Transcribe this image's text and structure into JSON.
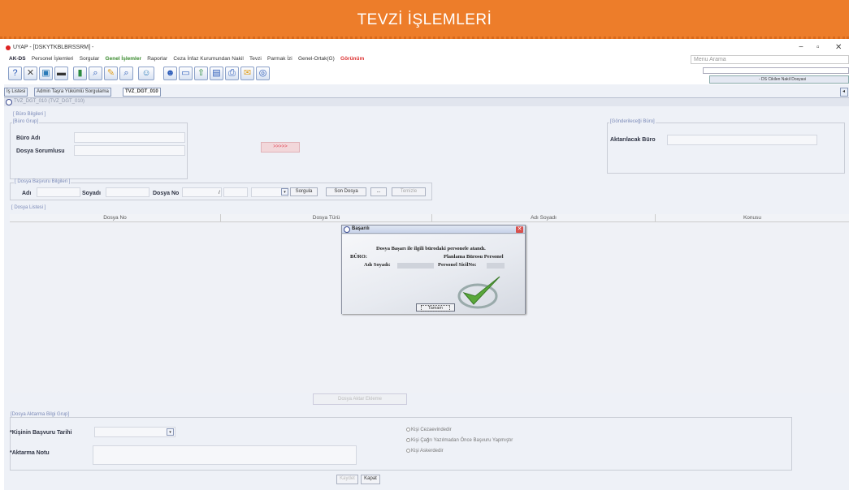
{
  "banner": {
    "title": "TEVZİ İŞLEMLERİ"
  },
  "window": {
    "title": "UYAP - [DSKYTKBLBRSSRM] -",
    "controls": {
      "minimize": "−",
      "restore": "▫",
      "close": "✕"
    }
  },
  "menu": {
    "items": [
      "AK-DS",
      "Personel İşlemleri",
      "Sorgular",
      "Genel İşlemler",
      "Raporlar",
      "Ceza İnfaz Kurumundan Nakil",
      "Tevzi",
      "Parmak İzi",
      "Genel-Ortak(G)",
      "Görünüm"
    ],
    "search_placeholder": "Menu Arama"
  },
  "right_panel": {
    "select_value": "- DS Cikilen Nakil Dosyasi"
  },
  "tabs": [
    {
      "label": "İş Listesi"
    },
    {
      "label": "Admin Taşra Yükümlü Sorgulama"
    },
    {
      "label": "TVZ_DGT_010"
    }
  ],
  "path": "TVZ_DGT_010 (TVZ_DGT_010)",
  "buro": {
    "group_title": "[ Büro Bilgileri ]",
    "subgroup_title": "[Büro Grup]",
    "buro_adi_label": "Büro Adı",
    "dosya_sorumlusu_label": "Dosya Sorumlusu",
    "transfer_button": ">>>>>",
    "target_group_title": "[Gönderileceği Büro]",
    "aktarilacak_buro_label": "Aktarılacak Büro"
  },
  "dosya_basvuru": {
    "group_title": "[ Dosya Başvuru Bilgileri ]",
    "adi_label": "Adı",
    "soyadi_label": "Soyadı",
    "dosya_no_label": "Dosya No",
    "slash": "/",
    "sorgula_button": "Sorgula",
    "son_dosya_button": "Son Dosya",
    "dots_button": "...",
    "temizle_button": "Temizle"
  },
  "dosya_listesi": {
    "group_title": "[ Dosya Listesi ]",
    "columns": [
      "Dosya No",
      "Dosya Türü",
      "Adı Soyadı",
      "Konusu"
    ]
  },
  "dialog": {
    "title": "Başarılı",
    "message": "Dosya Başarı ile ilgili bürodaki personele atandı.",
    "buro_label": "BÜRO:",
    "buro_value": "Planlama Bürosu Personel",
    "adi_soyadi_label": "Adı Soyadı:",
    "sicil_label": "Personel SicilNo:",
    "ok_button": "Tamam"
  },
  "bottom_center_button": "Dosya Aktar Ekleme",
  "aktarma": {
    "group_title": "[Dosya Aktarma Bilgi Grup]",
    "basvuru_tarihi_label": "*Kişinin Başvuru Tarihi",
    "aktarma_notu_label": "*Aktarma Notu",
    "options": [
      "Kişi Cezaevindedir",
      "Kişi Çağrı Yazılmadan Önce Başvuru Yapmıştır",
      "Kişi Askerdedir"
    ]
  },
  "footer": {
    "kaydet_button": "Kaydet",
    "kapat_button": "Kapat"
  }
}
